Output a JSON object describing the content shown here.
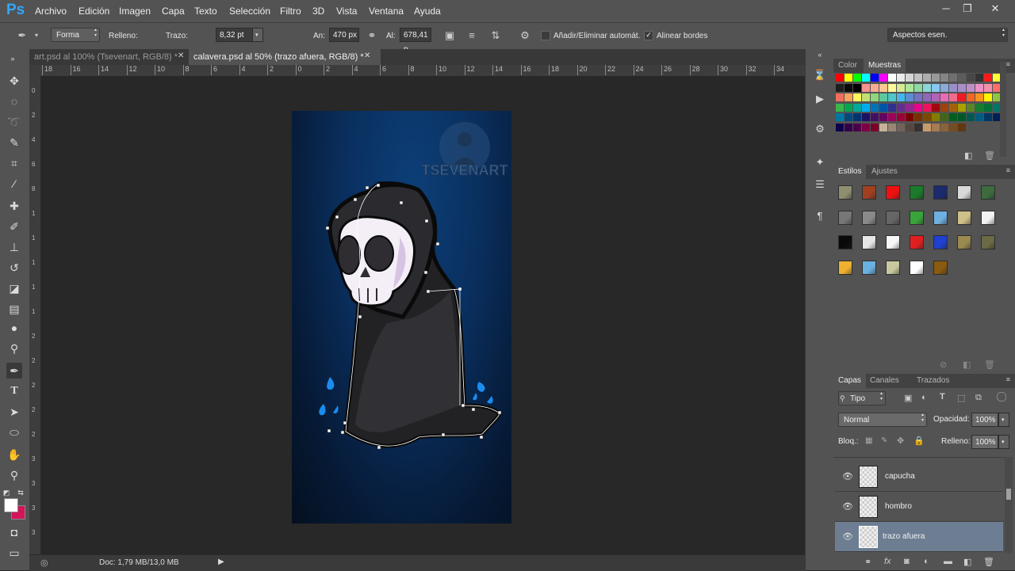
{
  "app": {
    "logo": "Ps"
  },
  "menu": [
    "Archivo",
    "Edición",
    "Imagen",
    "Capa",
    "Texto",
    "Selección",
    "Filtro",
    "3D",
    "Vista",
    "Ventana",
    "Ayuda"
  ],
  "window_controls": {
    "minimize": "─",
    "restore": "❐",
    "close": "✕"
  },
  "options": {
    "mode": "Forma",
    "fill_label": "Relleno:",
    "stroke_label": "Trazo:",
    "stroke_width": "8,32 pt",
    "width_label": "An:",
    "width_value": "470 px",
    "height_label": "Al:",
    "height_value": "678,41 p",
    "auto_add_delete": "Añadir/Eliminar automát.",
    "auto_add_delete_checked": false,
    "align_edges": "Alinear bordes",
    "align_edges_checked": true,
    "workspace": "Aspectos esen."
  },
  "tabs": [
    {
      "label": "art.psd al 100% (Tsevenart, RGB/8) *",
      "active": false
    },
    {
      "label": "calavera.psd al 50% (trazo afuera, RGB/8) *",
      "active": true
    }
  ],
  "ruler_h": [
    "18",
    "16",
    "14",
    "12",
    "10",
    "8",
    "6",
    "4",
    "2",
    "0",
    "2",
    "4",
    "6",
    "8",
    "10",
    "12",
    "14",
    "16",
    "18",
    "20",
    "22",
    "24",
    "26",
    "28",
    "30",
    "32",
    "34"
  ],
  "ruler_v": [
    "0",
    "2",
    "4",
    "6",
    "8",
    "1",
    "1",
    "1",
    "1",
    "1",
    "2",
    "2",
    "2",
    "2",
    "2",
    "3",
    "3",
    "3",
    "3"
  ],
  "watermark": "TSEVENART",
  "status": {
    "doc": "Doc: 1,79 MB/13,0 MB"
  },
  "color_panel": {
    "tabs": [
      "Color",
      "Muestras"
    ],
    "active": "Muestras",
    "swatches": [
      [
        "#ff0000",
        "#ffff00",
        "#00ff00",
        "#00ffff",
        "#0000ff",
        "#ff00ff",
        "#ffffff",
        "#ebebeb",
        "#d6d6d6",
        "#c2c2c2",
        "#adadad",
        "#999999",
        "#858585",
        "#707070",
        "#5c5c5c",
        "#474747",
        "#333333",
        "#ff1a1a",
        "#ffff33"
      ],
      [
        "#1f1f1f",
        "#0a0a0a",
        "#000000",
        "#f79191",
        "#f7ab91",
        "#fac891",
        "#fff799",
        "#d4ea95",
        "#ace698",
        "#8cd9a5",
        "#8ad6d8",
        "#86c8f0",
        "#8ba9da",
        "#9692c9",
        "#a88dc7",
        "#c08dc6",
        "#ec91c3",
        "#f291ac",
        "#ff6e6e"
      ],
      [
        "#f26e5c",
        "#f7a25b",
        "#fff55c",
        "#c1e071",
        "#8ed57e",
        "#5cc89b",
        "#4fc6c9",
        "#44b6ec",
        "#5b8fd2",
        "#7571bf",
        "#9068b8",
        "#b163b6",
        "#ec69b6",
        "#f06b8e",
        "#ed1c24",
        "#f26522",
        "#f7941d",
        "#fff200",
        "#8dc63f"
      ],
      [
        "#39b54a",
        "#00a651",
        "#00a99d",
        "#00aeef",
        "#0072bc",
        "#0054a6",
        "#2e3192",
        "#662d91",
        "#92278f",
        "#ec008c",
        "#ed145b",
        "#9e0b0f",
        "#a0410d",
        "#a3620a",
        "#aba000",
        "#598527",
        "#197b30",
        "#007236",
        "#00746b"
      ],
      [
        "#0076a3",
        "#004a80",
        "#003471",
        "#1b1464",
        "#440e62",
        "#630460",
        "#9e005d",
        "#9e0039",
        "#790000",
        "#7b2e00",
        "#7d4900",
        "#827b00",
        "#406618",
        "#005e20",
        "#005826",
        "#005952",
        "#005b7f",
        "#003663",
        "#002157"
      ],
      [
        "#0d004c",
        "#32004b",
        "#4b0049",
        "#7b0046",
        "#7a0026",
        "#c7b299",
        "#998675",
        "#736357",
        "#534741",
        "#37302d",
        "#c69c6d",
        "#a67c52",
        "#8c6239",
        "#754c24",
        "#603913"
      ]
    ]
  },
  "styles_panel": {
    "tabs": [
      "Estilos",
      "Ajustes"
    ],
    "active": "Estilos",
    "items": [
      [
        "#8f8f70",
        "#a04020",
        "#ee1111",
        "#1c7a2c",
        "#1c2a6e",
        "#d9d9d9",
        "#3e6b3e"
      ],
      [
        "#777777",
        "#8a8a8a",
        "#666666",
        "#3aa43a",
        "#6fb0e0",
        "#cfc08a",
        "#f2f2f2"
      ],
      [
        "#0a0a0a",
        "#e6e6e6",
        "#f7f7f7",
        "#e02020",
        "#2040d0",
        "#9a8a50",
        "#6a6a44"
      ],
      [
        "#f0b030",
        "#6ab0e0",
        "#c8c8a0",
        "#ffffff",
        "#8a5a10"
      ]
    ]
  },
  "layers_panel": {
    "tabs": [
      "Capas",
      "Canales",
      "Trazados"
    ],
    "active": "Capas",
    "filter": "Tipo",
    "blend_mode": "Normal",
    "opacity_label": "Opacidad:",
    "opacity": "100%",
    "lock_label": "Bloq.:",
    "fill_label": "Relleno:",
    "fill": "100%",
    "layers": [
      {
        "name": "capucha",
        "selected": false
      },
      {
        "name": "hombro",
        "selected": false
      },
      {
        "name": "trazo afuera",
        "selected": true
      }
    ]
  },
  "colors": {
    "accent": "#31a8ff",
    "foreground": "#ffffff",
    "background": "#d4145a"
  }
}
